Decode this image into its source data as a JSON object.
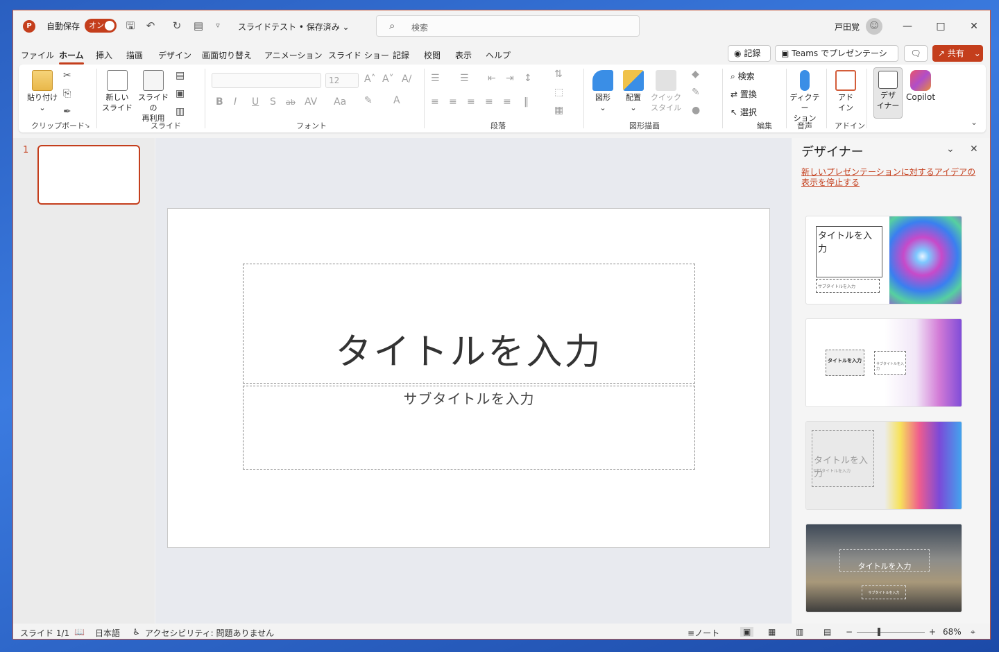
{
  "app": {
    "logo": "P",
    "autosave_label": "自動保存",
    "autosave_state": "オン",
    "doc_title": "スライドテスト • 保存済み",
    "accent": "#c43e1c"
  },
  "search": {
    "placeholder": "検索"
  },
  "user": {
    "name": "戸田覚"
  },
  "tabs": [
    "ファイル",
    "ホーム",
    "挿入",
    "描画",
    "デザイン",
    "画面切り替え",
    "アニメーション",
    "スライド ショー",
    "記録",
    "校閲",
    "表示",
    "ヘルプ"
  ],
  "header_buttons": {
    "record": "記録",
    "teams": "Teams でプレゼンテーション",
    "share": "共有"
  },
  "ribbon": {
    "clipboard": {
      "paste": "貼り付け",
      "label": "クリップボード"
    },
    "slides": {
      "new_slide_1": "新しい",
      "new_slide_2": "スライド",
      "reuse_1": "スライドの",
      "reuse_2": "再利用",
      "label": "スライド"
    },
    "font": {
      "size": "12",
      "label": "フォント",
      "bold": "B",
      "italic": "I",
      "underline": "U",
      "shadow": "S",
      "strike": "ab",
      "aa": "Aa"
    },
    "paragraph": {
      "label": "段落"
    },
    "drawing": {
      "shape": "図形",
      "arrange": "配置",
      "quick_1": "クイック",
      "quick_2": "スタイル",
      "label": "図形描画"
    },
    "editing": {
      "find": "検索",
      "replace": "置換",
      "select": "選択",
      "label": "編集"
    },
    "voice": {
      "dictate_1": "ディクテー",
      "dictate_2": "ション",
      "label": "音声"
    },
    "addins": {
      "addin_1": "アド",
      "addin_2": "イン",
      "label": "アドイン"
    },
    "designer": {
      "d1": "デザ",
      "d2": "イナー"
    },
    "copilot": {
      "label": "Copilot"
    }
  },
  "slide_panel": {
    "number": "1"
  },
  "slide": {
    "title": "タイトルを入力",
    "subtitle": "サブタイトルを入力"
  },
  "designer_pane": {
    "title": "デザイナー",
    "stop_link": "新しいプレゼンテーションに対するアイデアの表示を停止する",
    "cards": [
      {
        "title": "タイトルを入力",
        "subtitle": "サブタイトルを入力"
      },
      {
        "title": "タイトルを入力",
        "subtitle": "サブタイトルを入力"
      },
      {
        "title": "タイトルを入力",
        "subtitle": "サブタイトルを入力"
      },
      {
        "title": "タイトルを入力",
        "subtitle": "サブタイトルを入力"
      }
    ]
  },
  "status": {
    "slide": "スライド 1/1",
    "lang": "日本語",
    "accessibility": "アクセシビリティ: 問題ありません",
    "notes": "ノート",
    "zoom": "68%",
    "zoom_level": 0.68
  }
}
